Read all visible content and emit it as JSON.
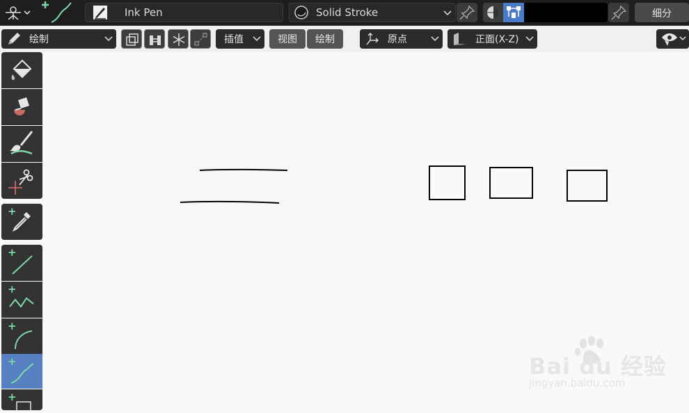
{
  "header": {
    "mode_icon": "grease-pencil-mode-icon",
    "active_tool_icon": "draw-curve-icon",
    "brush": {
      "icon": "ink-pen-brush-icon",
      "name": "Ink Pen"
    },
    "material": {
      "icon": "material-sphere-icon",
      "name": "Solid Stroke"
    },
    "color_mode_active": "vertex-color",
    "stroke_color": "#000000",
    "subdivide_label": "细分"
  },
  "toolbar": {
    "mode_label": "绘制",
    "interpolate_label": "插值",
    "view_label": "视图",
    "draw_label": "绘制",
    "origin_label": "原点",
    "plane_label": "正面(X-Z)"
  },
  "tools": [
    {
      "name": "fill-tool",
      "icon": "fill-bucket-icon"
    },
    {
      "name": "erase-tool",
      "icon": "eraser-icon"
    },
    {
      "name": "tint-tool",
      "icon": "brush-icon"
    },
    {
      "name": "cutter-tool",
      "icon": "scissors-icon"
    },
    {
      "name": "eyedropper-tool",
      "icon": "eyedropper-icon"
    },
    {
      "name": "line-tool",
      "icon": "line-icon"
    },
    {
      "name": "polyline-tool",
      "icon": "polyline-icon"
    },
    {
      "name": "arc-tool",
      "icon": "arc-icon"
    },
    {
      "name": "curve-tool",
      "icon": "curve-icon",
      "active": true
    },
    {
      "name": "box-tool",
      "icon": "box-icon"
    }
  ],
  "colors": {
    "accent": "#5680c2",
    "header_bg": "#1e1e1e",
    "canvas_bg": "#f9f9f9",
    "stroke": "#000000"
  },
  "watermark": {
    "brand": "Bai du 经验",
    "url": "jingyan.baidu.com"
  }
}
